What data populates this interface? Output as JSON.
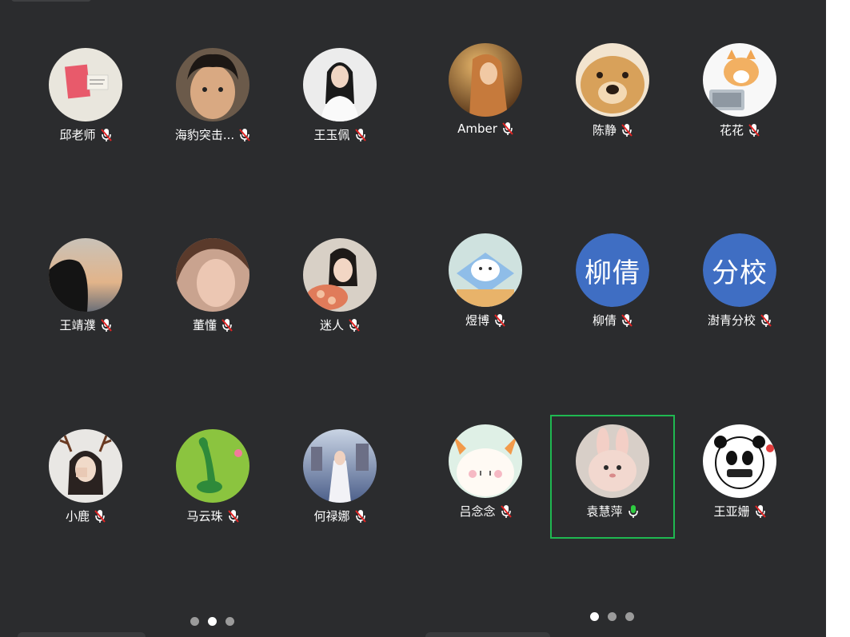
{
  "participants_left": [
    {
      "name": "邱老师",
      "mic": "muted",
      "avatar": "poster-photo"
    },
    {
      "name": "海豹突击...",
      "mic": "muted",
      "avatar": "boy-selfie"
    },
    {
      "name": "王玉佩",
      "mic": "muted",
      "avatar": "girl-white-shirt"
    },
    {
      "name": "王靖濮",
      "mic": "muted",
      "avatar": "hooded-sunset"
    },
    {
      "name": "董懂",
      "mic": "muted",
      "avatar": "girl-closeup"
    },
    {
      "name": "迷人",
      "mic": "muted",
      "avatar": "girl-flowers"
    },
    {
      "name": "小鹿",
      "mic": "muted",
      "avatar": "girl-antlers"
    },
    {
      "name": "马云珠",
      "mic": "muted",
      "avatar": "green-dino"
    },
    {
      "name": "何禄娜",
      "mic": "muted",
      "avatar": "girl-blue-city"
    }
  ],
  "participants_right": [
    {
      "name": "Amber",
      "mic": "muted",
      "avatar": "woman-golden"
    },
    {
      "name": "陈静",
      "mic": "muted",
      "avatar": "dog-face"
    },
    {
      "name": "花花",
      "mic": "muted",
      "avatar": "cat-laptop"
    },
    {
      "name": "煜博",
      "mic": "muted",
      "avatar": "cartoon-blue"
    },
    {
      "name": "柳倩",
      "mic": "muted",
      "avatar": "text",
      "avatar_text": "柳倩"
    },
    {
      "name": "澍青分校",
      "mic": "muted",
      "avatar": "text",
      "avatar_text": "分校"
    },
    {
      "name": "吕念念",
      "mic": "muted",
      "avatar": "bunny-cartoon"
    },
    {
      "name": "袁慧萍",
      "mic": "active",
      "avatar": "plush-bunny"
    },
    {
      "name": "王亚姗",
      "mic": "muted",
      "avatar": "panda-mascot"
    }
  ],
  "pagination_left": {
    "pages": 3,
    "current": 2
  },
  "pagination_right": {
    "pages": 3,
    "current": 1
  },
  "colors": {
    "background": "#2b2c2e",
    "speaking_border": "#1fb851",
    "muted_mic": "#ffffff",
    "muted_slash": "#e02424",
    "active_mic": "#2ecc40",
    "text_avatar": "#3f6ec3"
  }
}
